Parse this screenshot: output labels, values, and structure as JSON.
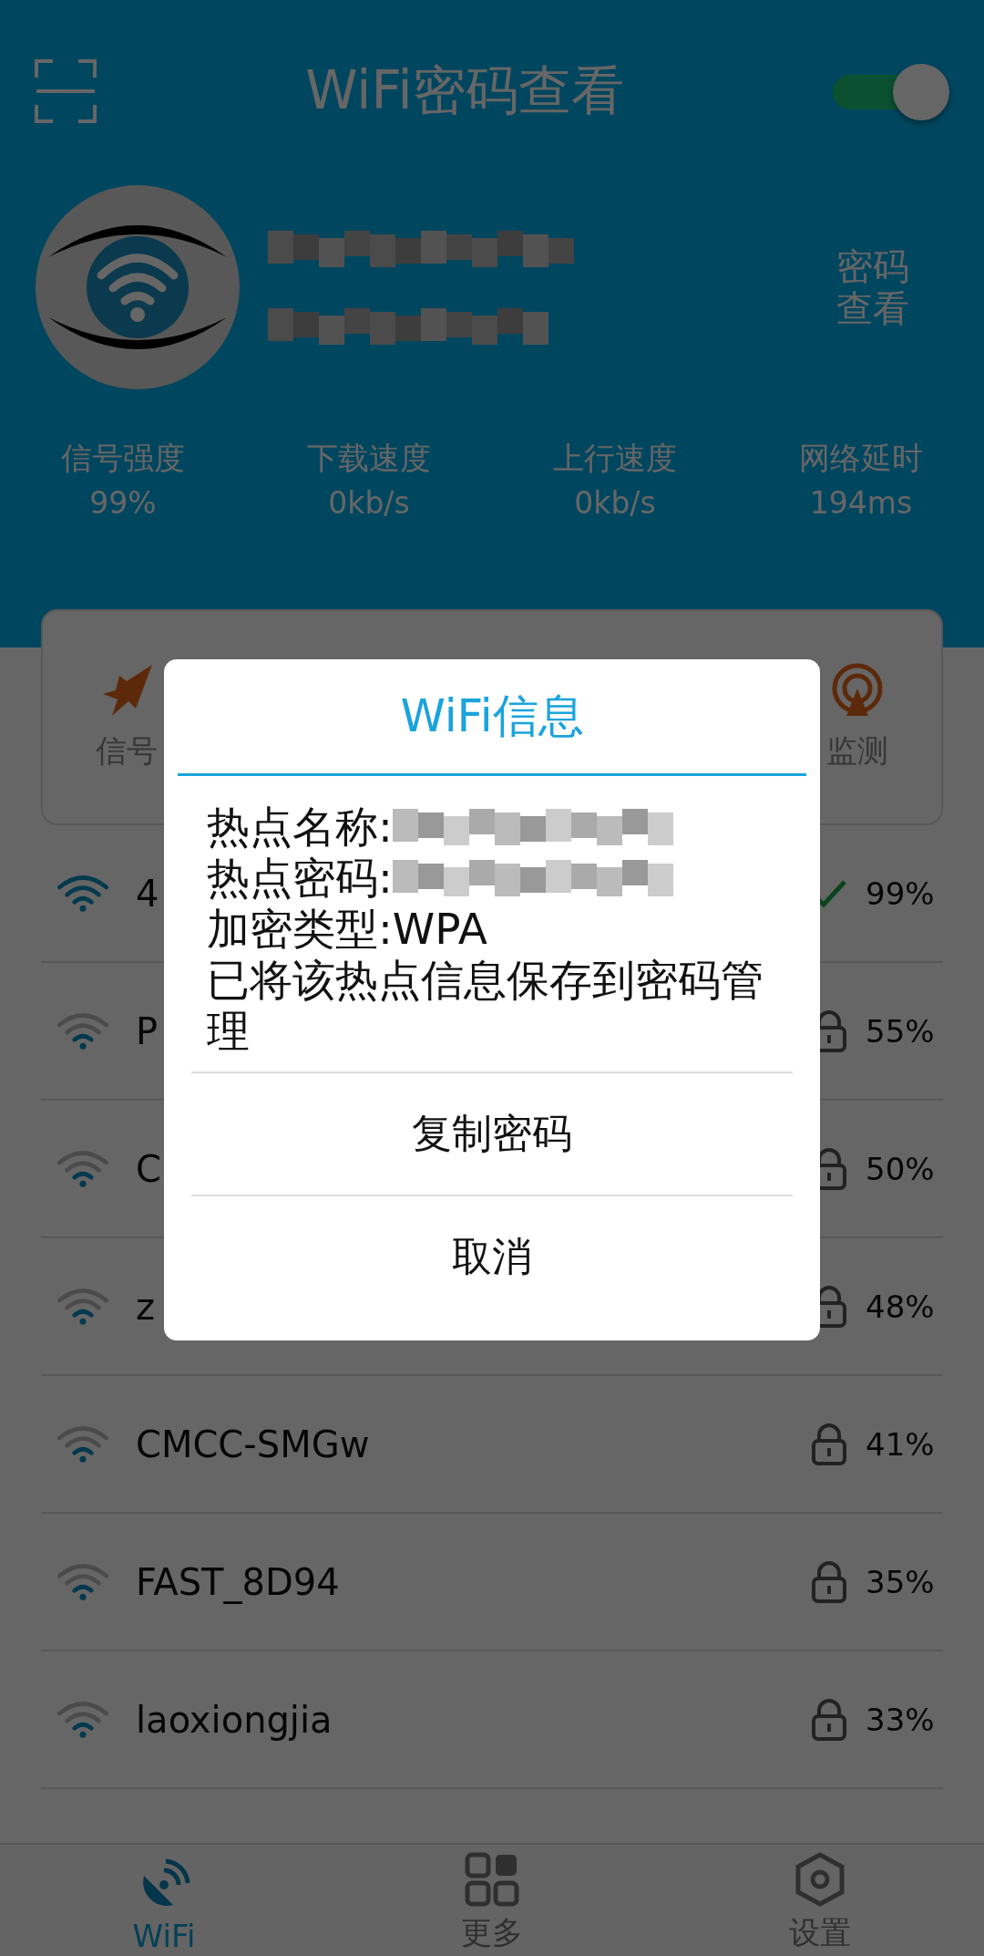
{
  "header": {
    "title": "WiFi密码查看",
    "toggle": {
      "on": true
    },
    "view_password": "密码查看"
  },
  "stats": [
    {
      "label": "信号强度",
      "value": "99%"
    },
    {
      "label": "下载速度",
      "value": "0kb/s"
    },
    {
      "label": "上行速度",
      "value": "0kb/s"
    },
    {
      "label": "网络延时",
      "value": "194ms"
    }
  ],
  "tools": [
    {
      "label": "信号",
      "kind": "boost"
    },
    {
      "label": "监测",
      "kind": "radar"
    }
  ],
  "networks": [
    {
      "name": "4",
      "connected": true,
      "locked": false,
      "signal": "99%"
    },
    {
      "name": "P",
      "connected": false,
      "locked": true,
      "signal": "55%"
    },
    {
      "name": "C",
      "connected": false,
      "locked": true,
      "signal": "50%"
    },
    {
      "name": "z",
      "connected": false,
      "locked": true,
      "signal": "48%"
    },
    {
      "name": "CMCC-SMGw",
      "connected": false,
      "locked": true,
      "signal": "41%"
    },
    {
      "name": "FAST_8D94",
      "connected": false,
      "locked": true,
      "signal": "35%"
    },
    {
      "name": "laoxiongjia",
      "connected": false,
      "locked": true,
      "signal": "33%"
    }
  ],
  "dialog": {
    "title": "WiFi信息",
    "lines": [
      {
        "text": "热点名称:",
        "redacted": true
      },
      {
        "text": "热点密码:",
        "redacted": true
      },
      {
        "text": "加密类型:WPA",
        "redacted": false
      },
      {
        "text": "已将该热点信息保存到密码管理",
        "redacted": false
      }
    ],
    "buttons": [
      "复制密码",
      "取消"
    ]
  },
  "nav": [
    {
      "label": "WiFi",
      "kind": "wifi",
      "selected": true
    },
    {
      "label": "更多",
      "kind": "grid",
      "selected": false
    },
    {
      "label": "设置",
      "kind": "settings",
      "selected": false
    }
  ]
}
